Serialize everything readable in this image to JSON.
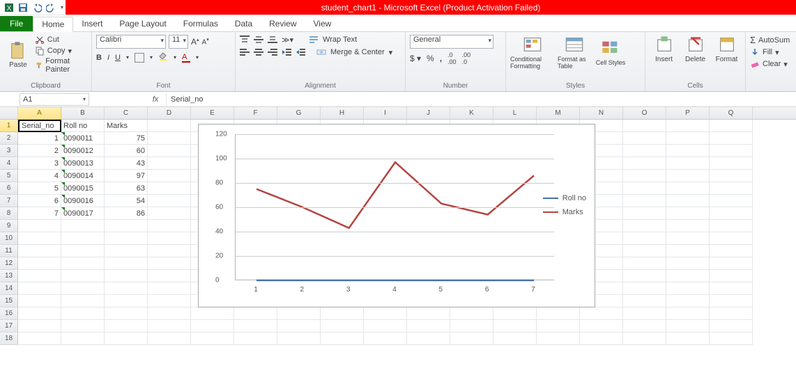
{
  "title": "student_chart1 - Microsoft Excel (Product Activation Failed)",
  "tabs": {
    "file": "File",
    "home": "Home",
    "insert": "Insert",
    "page": "Page Layout",
    "formulas": "Formulas",
    "data": "Data",
    "review": "Review",
    "view": "View"
  },
  "clipboard": {
    "paste": "Paste",
    "cut": "Cut",
    "copy": "Copy",
    "fp": "Format Painter",
    "label": "Clipboard"
  },
  "font": {
    "name": "Calibri",
    "size": "11",
    "label": "Font"
  },
  "align": {
    "wrap": "Wrap Text",
    "merge": "Merge & Center",
    "label": "Alignment"
  },
  "number": {
    "format": "General",
    "label": "Number"
  },
  "styles": {
    "cf": "Conditional Formatting",
    "fat": "Format as Table",
    "cs": "Cell Styles",
    "label": "Styles"
  },
  "cellsg": {
    "ins": "Insert",
    "del": "Delete",
    "fmt": "Format",
    "label": "Cells"
  },
  "edit": {
    "sum": "AutoSum",
    "fill": "Fill",
    "clr": "Clear"
  },
  "namebox": "A1",
  "fxval": "Serial_no",
  "cols": [
    "A",
    "B",
    "C",
    "D",
    "E",
    "F",
    "G",
    "H",
    "I",
    "J",
    "K",
    "L",
    "M",
    "N",
    "O",
    "P",
    "Q"
  ],
  "rownums": [
    "1",
    "2",
    "3",
    "4",
    "5",
    "6",
    "7",
    "8",
    "9",
    "10",
    "11",
    "12",
    "13",
    "14",
    "15",
    "16",
    "17",
    "18"
  ],
  "table": {
    "headers": [
      "Serial_no",
      "Roll no",
      "Marks"
    ],
    "rows": [
      [
        "1",
        "0090011",
        "75"
      ],
      [
        "2",
        "0090012",
        "60"
      ],
      [
        "3",
        "0090013",
        "43"
      ],
      [
        "4",
        "0090014",
        "97"
      ],
      [
        "5",
        "0090015",
        "63"
      ],
      [
        "6",
        "0090016",
        "54"
      ],
      [
        "7",
        "0090017",
        "86"
      ]
    ]
  },
  "legend": {
    "s1": "Roll no",
    "s2": "Marks"
  },
  "colors": {
    "rollno": "#4472a8",
    "marks": "#b34440"
  },
  "chart_data": {
    "type": "line",
    "categories": [
      "1",
      "2",
      "3",
      "4",
      "5",
      "6",
      "7"
    ],
    "series": [
      {
        "name": "Roll no",
        "values": [
          0,
          0,
          0,
          0,
          0,
          0,
          0
        ]
      },
      {
        "name": "Marks",
        "values": [
          75,
          60,
          43,
          97,
          63,
          54,
          86
        ]
      }
    ],
    "xlabel": "",
    "ylabel": "",
    "ylim": [
      0,
      120
    ],
    "yticks": [
      0,
      20,
      40,
      60,
      80,
      100,
      120
    ]
  }
}
